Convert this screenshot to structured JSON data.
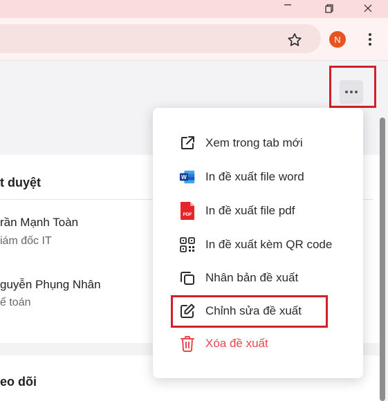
{
  "browser": {
    "profile_initial": "N",
    "accent_color": "#e8541f",
    "icons": [
      "minimize-icon",
      "restore-icon",
      "close-icon",
      "star-icon",
      "kebab-menu-icon"
    ]
  },
  "page": {
    "approval_card": {
      "title": "t duyệt",
      "people": [
        {
          "name": "rần Mạnh Toàn",
          "role": "iám đốc IT"
        },
        {
          "name": "guyễn Phụng Nhân",
          "role": "ế toán"
        }
      ]
    },
    "follow_card": {
      "title": "eo dõi"
    }
  },
  "menu": {
    "items": [
      {
        "label": "Xem trong tab mới",
        "icon": "external-link-icon"
      },
      {
        "label": "In đề xuất file word",
        "icon": "word-icon"
      },
      {
        "label": "In đề xuất file pdf",
        "icon": "pdf-icon"
      },
      {
        "label": "In đề xuất kèm QR code",
        "icon": "qr-code-icon"
      },
      {
        "label": "Nhân bản đề xuất",
        "icon": "copy-icon"
      },
      {
        "label": "Chỉnh sửa đề xuất",
        "icon": "edit-icon"
      },
      {
        "label": "Xóa đề xuất",
        "icon": "trash-icon"
      }
    ],
    "danger_color": "#e5484d",
    "highlight_color": "#d0202a"
  }
}
